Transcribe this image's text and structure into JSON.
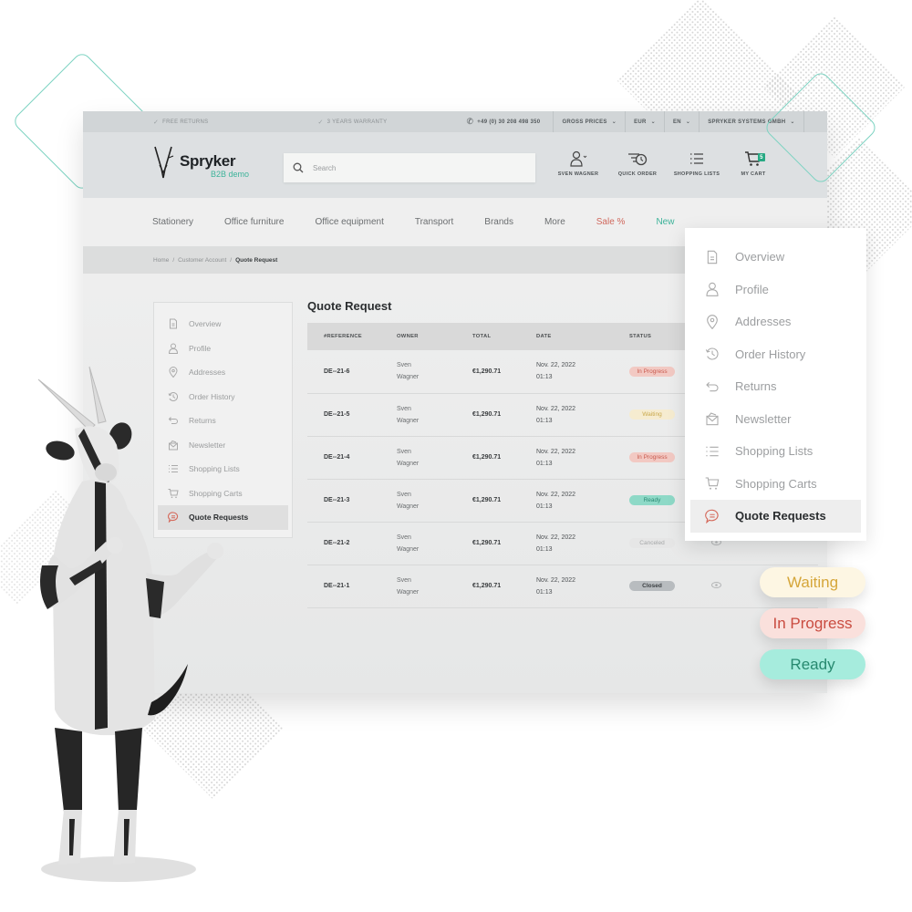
{
  "topbar": {
    "free_returns": "FREE RETURNS",
    "warranty": "3 YEARS WARRANTY",
    "phone": "+49 (0) 30 208 498 350",
    "dropdowns": [
      {
        "label": "GROSS PRICES"
      },
      {
        "label": "EUR"
      },
      {
        "label": "EN"
      },
      {
        "label": "SPRYKER SYSTEMS GMBH"
      }
    ]
  },
  "header": {
    "brand_name": "Spryker",
    "brand_sub": "B2B demo",
    "search_placeholder": "Search",
    "actions": {
      "user": "SVEN WAGNER",
      "quick_order": "QUICK ORDER",
      "shopping_lists": "SHOPPING LISTS",
      "cart": "MY CART",
      "cart_count": "5"
    }
  },
  "nav": {
    "items": [
      "Stationery",
      "Office furniture",
      "Office equipment",
      "Transport",
      "Brands",
      "More"
    ],
    "sale": "Sale %",
    "new": "New"
  },
  "breadcrumb": [
    "Home",
    "Customer Account",
    "Quote Request"
  ],
  "sidebar": {
    "items": [
      {
        "label": "Overview",
        "icon": "document-icon"
      },
      {
        "label": "Profile",
        "icon": "user-icon"
      },
      {
        "label": "Addresses",
        "icon": "location-pin-icon"
      },
      {
        "label": "Order History",
        "icon": "history-icon"
      },
      {
        "label": "Returns",
        "icon": "return-arrow-icon"
      },
      {
        "label": "Newsletter",
        "icon": "mail-icon"
      },
      {
        "label": "Shopping Lists",
        "icon": "list-icon"
      },
      {
        "label": "Shopping Carts",
        "icon": "cart-icon"
      },
      {
        "label": "Quote Requests",
        "icon": "chat-bubble-icon",
        "active": true
      }
    ]
  },
  "main": {
    "title": "Quote Request",
    "columns": [
      "#REFERENCE",
      "OWNER",
      "TOTAL",
      "DATE",
      "STATUS"
    ],
    "rows": [
      {
        "reference": "DE--21-6",
        "owner_first": "Sven",
        "owner_last": "Wagner",
        "total": "€1,290.71",
        "date": "Nov. 22, 2022",
        "time": "01:13",
        "status": "In Progress"
      },
      {
        "reference": "DE--21-5",
        "owner_first": "Sven",
        "owner_last": "Wagner",
        "total": "€1,290.71",
        "date": "Nov. 22, 2022",
        "time": "01:13",
        "status": "Waiting"
      },
      {
        "reference": "DE--21-4",
        "owner_first": "Sven",
        "owner_last": "Wagner",
        "total": "€1,290.71",
        "date": "Nov. 22, 2022",
        "time": "01:13",
        "status": "In Progress"
      },
      {
        "reference": "DE--21-3",
        "owner_first": "Sven",
        "owner_last": "Wagner",
        "total": "€1,290.71",
        "date": "Nov. 22, 2022",
        "time": "01:13",
        "status": "Ready"
      },
      {
        "reference": "DE--21-2",
        "owner_first": "Sven",
        "owner_last": "Wagner",
        "total": "€1,290.71",
        "date": "Nov. 22, 2022",
        "time": "01:13",
        "status": "Canceled"
      },
      {
        "reference": "DE--21-1",
        "owner_first": "Sven",
        "owner_last": "Wagner",
        "total": "€1,290.71",
        "date": "Nov. 22, 2022",
        "time": "01:13",
        "status": "Closed"
      }
    ]
  },
  "menu_card": {
    "items": [
      {
        "label": "Overview"
      },
      {
        "label": "Profile"
      },
      {
        "label": "Addresses"
      },
      {
        "label": "Order History"
      },
      {
        "label": "Returns"
      },
      {
        "label": "Newsletter"
      },
      {
        "label": "Shopping Lists"
      },
      {
        "label": "Shopping Carts"
      },
      {
        "label": "Quote Requests",
        "active": true
      }
    ]
  },
  "status_pills": [
    "Waiting",
    "In Progress",
    "Ready"
  ],
  "colors": {
    "accent_green": "#3db39a",
    "sale_red": "#d0685d",
    "status_in_progress": "#f2c9c3",
    "status_waiting": "#f6ecd0",
    "status_ready": "#8ed9c7",
    "status_canceled": "#e6e6e6",
    "status_closed": "#b8bcbf"
  }
}
